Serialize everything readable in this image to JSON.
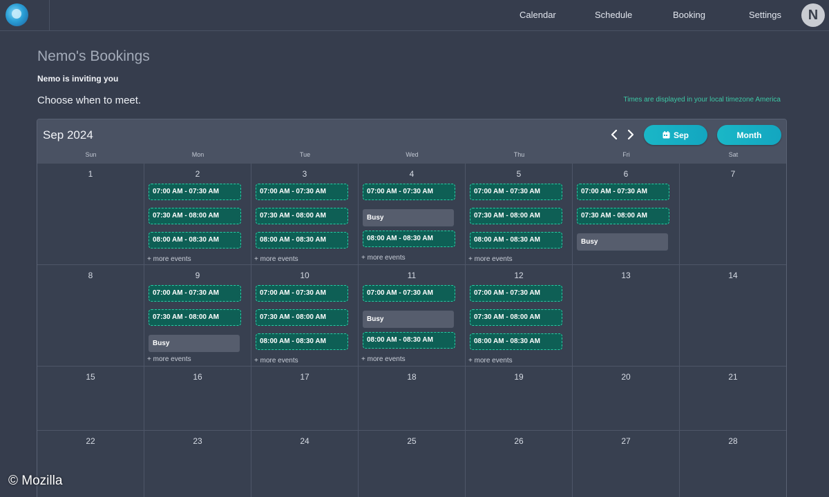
{
  "nav": {
    "links": [
      "Calendar",
      "Schedule",
      "Booking",
      "Settings"
    ],
    "avatar_initial": "N"
  },
  "page": {
    "title": "Nemo's Bookings",
    "subtitle": "Nemo is inviting you",
    "prompt": "Choose when to meet.",
    "timezone_note": "Times are displayed in your local timezone America"
  },
  "calendar": {
    "month_label": "Sep 2024",
    "today_button": "Sep",
    "view_button": "Month",
    "weekdays": [
      "Sun",
      "Mon",
      "Tue",
      "Wed",
      "Thu",
      "Fri",
      "Sat"
    ],
    "more_label": "+ more events",
    "weeks": [
      [
        {
          "day": "1",
          "events": []
        },
        {
          "day": "2",
          "events": [
            {
              "t": "slot",
              "label": "07:00 AM - 07:30 AM"
            },
            {
              "t": "slot",
              "label": "07:30 AM - 08:00 AM"
            },
            {
              "t": "slot",
              "label": "08:00 AM - 08:30 AM"
            }
          ],
          "more": true
        },
        {
          "day": "3",
          "events": [
            {
              "t": "slot",
              "label": "07:00 AM - 07:30 AM"
            },
            {
              "t": "slot",
              "label": "07:30 AM - 08:00 AM"
            },
            {
              "t": "slot",
              "label": "08:00 AM - 08:30 AM"
            }
          ],
          "more": true
        },
        {
          "day": "4",
          "events": [
            {
              "t": "slot",
              "label": "07:00 AM - 07:30 AM"
            },
            {
              "t": "busy",
              "label": "Busy"
            },
            {
              "t": "slot",
              "label": "08:00 AM - 08:30 AM"
            }
          ],
          "more": true
        },
        {
          "day": "5",
          "events": [
            {
              "t": "slot",
              "label": "07:00 AM - 07:30 AM"
            },
            {
              "t": "slot",
              "label": "07:30 AM - 08:00 AM"
            },
            {
              "t": "slot",
              "label": "08:00 AM - 08:30 AM"
            }
          ],
          "more": true
        },
        {
          "day": "6",
          "events": [
            {
              "t": "slot",
              "label": "07:00 AM - 07:30 AM"
            },
            {
              "t": "slot",
              "label": "07:30 AM - 08:00 AM"
            },
            {
              "t": "busy",
              "label": "Busy"
            }
          ],
          "more": false
        },
        {
          "day": "7",
          "events": []
        }
      ],
      [
        {
          "day": "8",
          "events": []
        },
        {
          "day": "9",
          "events": [
            {
              "t": "slot",
              "label": "07:00 AM - 07:30 AM"
            },
            {
              "t": "slot",
              "label": "07:30 AM - 08:00 AM"
            },
            {
              "t": "busy",
              "label": "Busy"
            }
          ],
          "more": true
        },
        {
          "day": "10",
          "events": [
            {
              "t": "slot",
              "label": "07:00 AM - 07:30 AM"
            },
            {
              "t": "slot",
              "label": "07:30 AM - 08:00 AM"
            },
            {
              "t": "slot",
              "label": "08:00 AM - 08:30 AM"
            }
          ],
          "more": true
        },
        {
          "day": "11",
          "events": [
            {
              "t": "slot",
              "label": "07:00 AM - 07:30 AM"
            },
            {
              "t": "busy",
              "label": "Busy"
            },
            {
              "t": "slot",
              "label": "08:00 AM - 08:30 AM"
            }
          ],
          "more": true
        },
        {
          "day": "12",
          "events": [
            {
              "t": "slot",
              "label": "07:00 AM - 07:30 AM"
            },
            {
              "t": "slot",
              "label": "07:30 AM - 08:00 AM"
            },
            {
              "t": "slot",
              "label": "08:00 AM - 08:30 AM"
            }
          ],
          "more": true
        },
        {
          "day": "13",
          "events": []
        },
        {
          "day": "14",
          "events": []
        }
      ],
      [
        {
          "day": "15",
          "events": []
        },
        {
          "day": "16",
          "events": []
        },
        {
          "day": "17",
          "events": []
        },
        {
          "day": "18",
          "events": []
        },
        {
          "day": "19",
          "events": []
        },
        {
          "day": "20",
          "events": []
        },
        {
          "day": "21",
          "events": []
        }
      ],
      [
        {
          "day": "22",
          "events": []
        },
        {
          "day": "23",
          "events": []
        },
        {
          "day": "24",
          "events": []
        },
        {
          "day": "25",
          "events": []
        },
        {
          "day": "26",
          "events": []
        },
        {
          "day": "27",
          "events": []
        },
        {
          "day": "28",
          "events": []
        }
      ]
    ]
  },
  "watermark": "© Mozilla",
  "colors": {
    "background": "#363d4d",
    "slot_fill": "#0e5f55",
    "slot_border": "#27cfa5",
    "busy_fill": "#565d6d",
    "accent": "#1ab7c7",
    "timezone_text": "#3dc9a6"
  }
}
